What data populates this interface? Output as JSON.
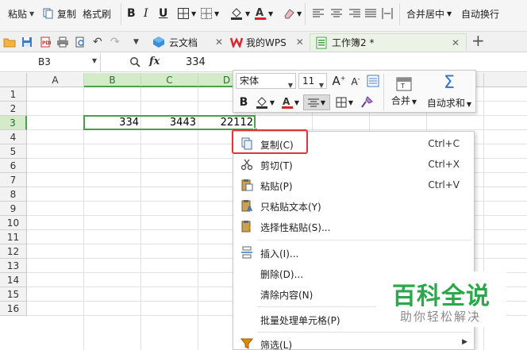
{
  "ribbon": {
    "paste": "粘贴",
    "copy": "复制",
    "format_painter": "格式刷",
    "bold": "B",
    "italic": "I",
    "underline": "U",
    "merge_center": "合并居中",
    "auto_wrap": "自动换行"
  },
  "tabs": [
    {
      "label": "云文档",
      "icon": "cloud-doc-icon"
    },
    {
      "label": "我的WPS",
      "icon": "wps-logo-icon"
    },
    {
      "label": "工作簿2 *",
      "icon": "workbook-icon"
    }
  ],
  "formula_bar": {
    "name_box": "B3",
    "fx": "fx",
    "value": "334"
  },
  "grid": {
    "columns": [
      "A",
      "B",
      "C",
      "D"
    ],
    "rows": [
      "1",
      "2",
      "3",
      "4",
      "5",
      "6",
      "7",
      "8",
      "9",
      "10",
      "11",
      "12",
      "13",
      "14",
      "15",
      "16"
    ],
    "cells": {
      "B3": "334",
      "C3": "3443",
      "D3": "22112"
    }
  },
  "mini_toolbar": {
    "font_name": "宋体",
    "font_size": "11",
    "bold": "B",
    "merge": "合并",
    "auto_sum": "自动求和"
  },
  "context_menu": [
    {
      "label": "复制(C)",
      "shortcut": "Ctrl+C",
      "icon": "copy-icon"
    },
    {
      "label": "剪切(T)",
      "shortcut": "Ctrl+X",
      "icon": "scissors-icon"
    },
    {
      "label": "粘贴(P)",
      "shortcut": "Ctrl+V",
      "icon": "paste-icon"
    },
    {
      "label": "只粘贴文本(Y)",
      "shortcut": "",
      "icon": "paste-text-icon"
    },
    {
      "label": "选择性粘贴(S)...",
      "shortcut": "",
      "icon": "paste-special-icon"
    },
    {
      "label": "插入(I)...",
      "shortcut": "",
      "icon": "insert-icon"
    },
    {
      "label": "删除(D)...",
      "shortcut": "",
      "icon": ""
    },
    {
      "label": "清除内容(N)",
      "shortcut": "",
      "icon": ""
    },
    {
      "label": "批量处理单元格(P)",
      "shortcut": "",
      "icon": ""
    },
    {
      "label": "筛选(L)",
      "shortcut": "",
      "icon": "filter-icon"
    }
  ],
  "watermark": {
    "title": "百科全说",
    "subtitle": "助你轻松解决"
  },
  "colors": {
    "accent_green": "#4aa04a",
    "highlight_red": "#e0363a",
    "watermark_green": "#2aa84a"
  }
}
